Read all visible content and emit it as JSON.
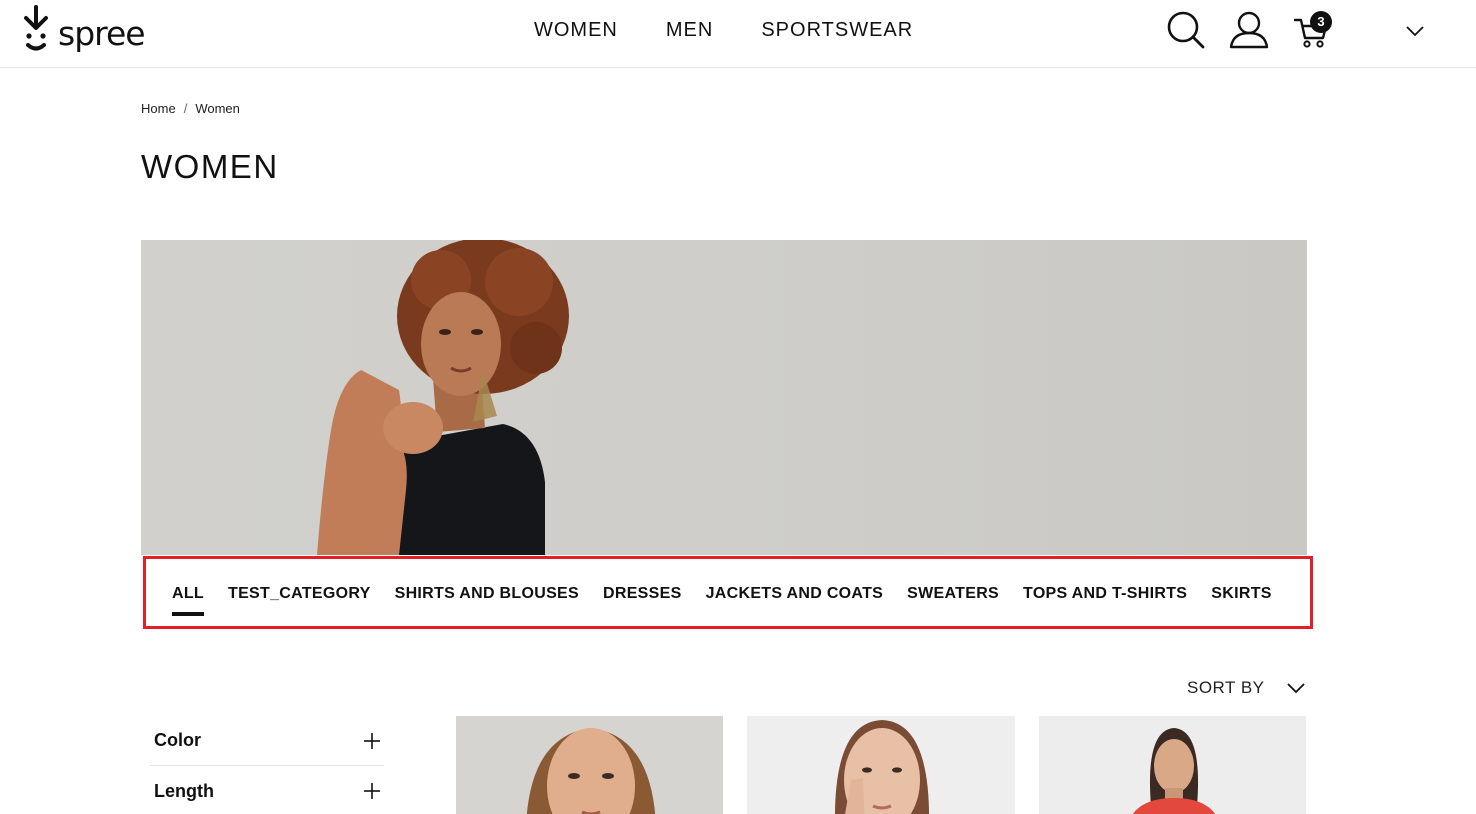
{
  "header": {
    "logo_text": "spree",
    "nav": [
      "WOMEN",
      "MEN",
      "SPORTSWEAR"
    ],
    "icons": [
      "search-icon",
      "account-icon",
      "cart-icon",
      "chevron-down-icon"
    ],
    "cart_count": "3"
  },
  "breadcrumb": {
    "home": "Home",
    "separator": "/",
    "current": "Women"
  },
  "page": {
    "title": "WOMEN"
  },
  "tabs": {
    "items": [
      "ALL",
      "TEST_CATEGORY",
      "SHIRTS AND BLOUSES",
      "DRESSES",
      "JACKETS AND COATS",
      "SWEATERS",
      "TOPS AND T-SHIRTS",
      "SKIRTS"
    ],
    "active": "ALL",
    "highlight_color": "#e41e26"
  },
  "sort": {
    "label": "SORT BY"
  },
  "filters": {
    "items": [
      "Color",
      "Length"
    ]
  },
  "products": [
    "product-card-1",
    "product-card-2",
    "product-card-3"
  ]
}
